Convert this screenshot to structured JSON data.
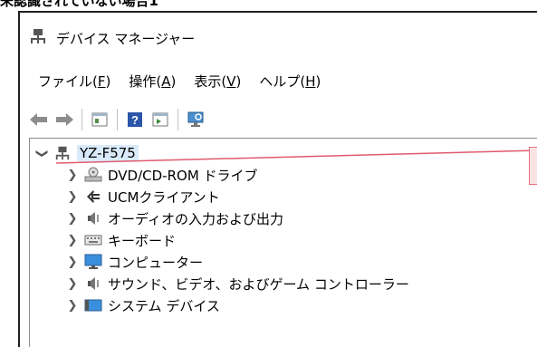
{
  "caption": "未認識されていない場合1",
  "window": {
    "title": "デバイス マネージャー"
  },
  "menu": [
    {
      "label": "ファイル(",
      "key": "F",
      "tail": ")"
    },
    {
      "label": "操作(",
      "key": "A",
      "tail": ")"
    },
    {
      "label": "表示(",
      "key": "V",
      "tail": ")"
    },
    {
      "label": "ヘルプ(",
      "key": "H",
      "tail": ")"
    }
  ],
  "tree": {
    "root": "YZ-F575",
    "children": [
      {
        "label": "DVD/CD-ROM ドライブ",
        "icon": "dvd-drive-icon"
      },
      {
        "label": "UCMクライアント",
        "icon": "ucm-client-icon"
      },
      {
        "label": "オーディオの入力および出力",
        "icon": "speaker-icon"
      },
      {
        "label": "キーボード",
        "icon": "keyboard-icon"
      },
      {
        "label": "コンピューター",
        "icon": "monitor-icon"
      },
      {
        "label": "サウンド、ビデオ、およびゲーム コントローラー",
        "icon": "speaker-icon"
      },
      {
        "label": "システム デバイス",
        "icon": "system-devices-icon"
      }
    ]
  },
  "colors": {
    "annotation": "#e05a6e",
    "selection": "#d9ebfa"
  }
}
